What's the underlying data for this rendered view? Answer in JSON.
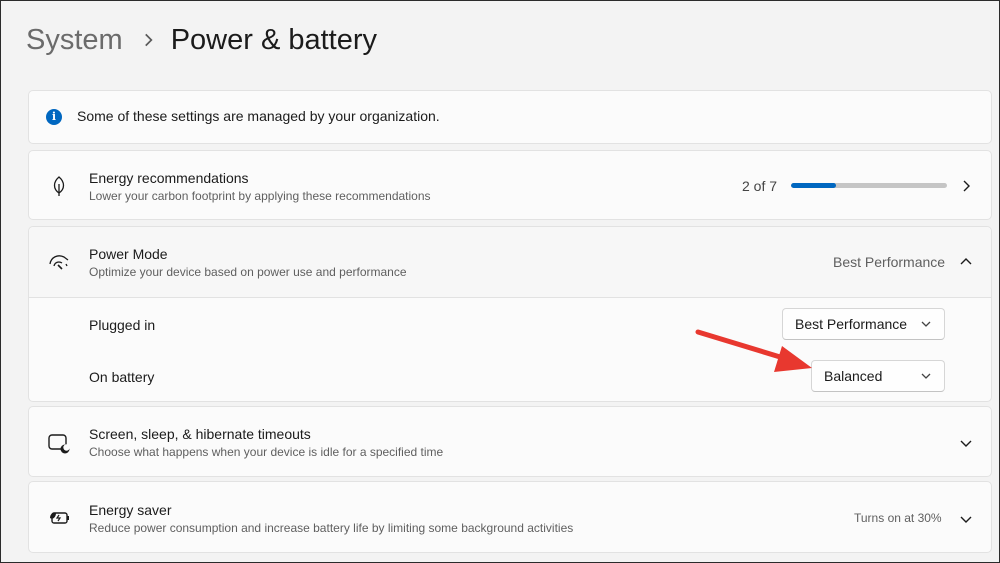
{
  "breadcrumb": {
    "parent": "System",
    "current": "Power & battery"
  },
  "info_banner": {
    "icon": "info-icon",
    "text": "Some of these settings are managed by your organization."
  },
  "energy_recommendations": {
    "icon": "leaf-icon",
    "title": "Energy recommendations",
    "subtitle": "Lower your carbon footprint by applying these recommendations",
    "progress_text": "2 of 7",
    "progress_completed": 2,
    "progress_total": 7
  },
  "power_mode": {
    "icon": "gauge-icon",
    "title": "Power Mode",
    "subtitle": "Optimize your device based on power use and performance",
    "current_value": "Best Performance",
    "expanded": true,
    "plugged_in": {
      "label": "Plugged in",
      "selected": "Best Performance"
    },
    "on_battery": {
      "label": "On battery",
      "selected": "Balanced"
    }
  },
  "screen_sleep": {
    "icon": "screen-sleep-icon",
    "title": "Screen, sleep, & hibernate timeouts",
    "subtitle": "Choose what happens when your device is idle for a specified time"
  },
  "energy_saver": {
    "icon": "energy-saver-icon",
    "title": "Energy saver",
    "subtitle": "Reduce power consumption and increase battery life by limiting some background activities",
    "status": "Turns on at 30%"
  },
  "colors": {
    "accent": "#0067c0",
    "annotation_arrow": "#e8382f"
  }
}
